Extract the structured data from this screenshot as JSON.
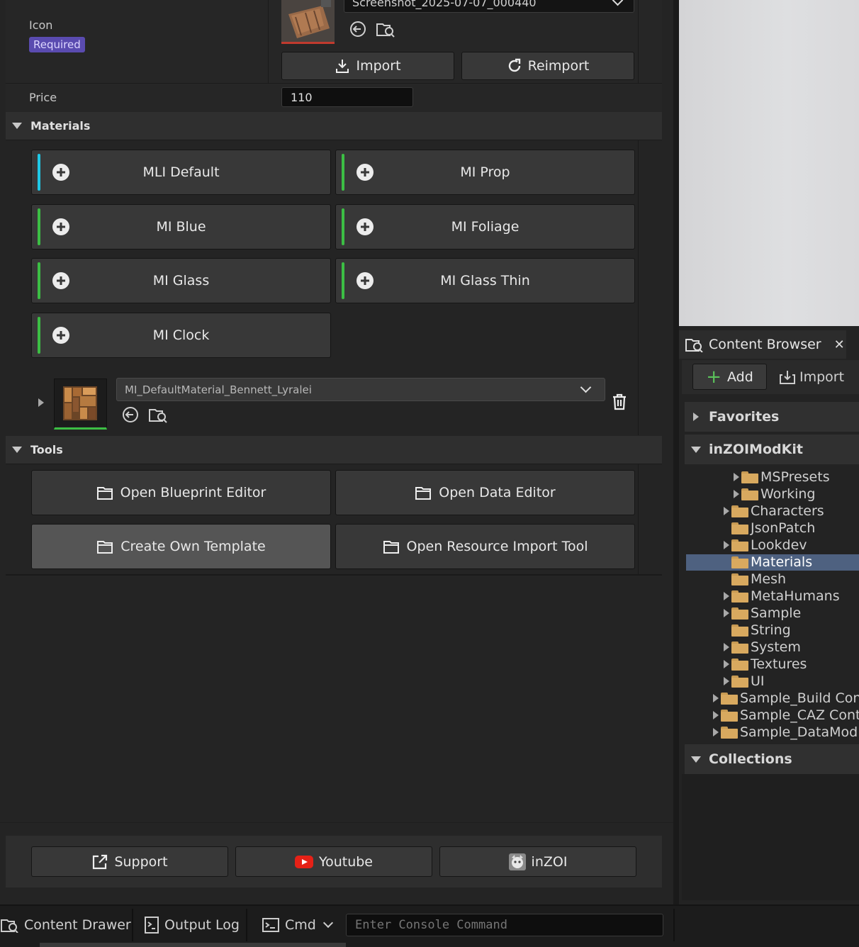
{
  "details": {
    "icon_label": "Icon",
    "required_badge": "Required",
    "icon_asset_name": "Screenshot_2025-07-07_000440",
    "import_label": "Import",
    "reimport_label": "Reimport",
    "price_label": "Price",
    "price_value": "110"
  },
  "materials": {
    "header": "Materials",
    "items": [
      {
        "label": "MLI Default",
        "accent": "#1ec8e6"
      },
      {
        "label": "MI Prop",
        "accent": "#3cbe44"
      },
      {
        "label": "MI Blue",
        "accent": "#3cbe44"
      },
      {
        "label": "MI Foliage",
        "accent": "#3cbe44"
      },
      {
        "label": "MI Glass",
        "accent": "#3cbe44"
      },
      {
        "label": "MI Glass Thin",
        "accent": "#3cbe44"
      },
      {
        "label": "MI Clock",
        "accent": "#3cbe44"
      }
    ],
    "selected_material": "MI_DefaultMaterial_Bennett_Lyralei"
  },
  "tools": {
    "header": "Tools",
    "open_blueprint_editor": "Open Blueprint Editor",
    "open_data_editor": "Open Data Editor",
    "create_own_template": "Create Own Template",
    "open_resource_import_tool": "Open Resource Import Tool"
  },
  "links": {
    "support": "Support",
    "youtube": "Youtube",
    "inzoi": "inZOI"
  },
  "content_browser": {
    "tab_title": "Content Browser",
    "add_label": "Add",
    "import_label": "Import",
    "favorites_label": "Favorites",
    "root_label": "inZOIModKit",
    "collections_label": "Collections",
    "tree": [
      {
        "label": "MSPresets",
        "expandable": true,
        "selected": false
      },
      {
        "label": "Working",
        "expandable": true,
        "selected": false
      },
      {
        "label": "Characters",
        "expandable": true,
        "selected": false
      },
      {
        "label": "JsonPatch",
        "expandable": false,
        "selected": false
      },
      {
        "label": "Lookdev",
        "expandable": true,
        "selected": false
      },
      {
        "label": "Materials",
        "expandable": false,
        "selected": true
      },
      {
        "label": "Mesh",
        "expandable": false,
        "selected": false
      },
      {
        "label": "MetaHumans",
        "expandable": true,
        "selected": false
      },
      {
        "label": "Sample",
        "expandable": true,
        "selected": false
      },
      {
        "label": "String",
        "expandable": false,
        "selected": false
      },
      {
        "label": "System",
        "expandable": true,
        "selected": false
      },
      {
        "label": "Textures",
        "expandable": true,
        "selected": false
      },
      {
        "label": "UI",
        "expandable": true,
        "selected": false
      },
      {
        "label": "Sample_Build Cont",
        "expandable": true,
        "selected": false
      },
      {
        "label": "Sample_CAZ Conte",
        "expandable": true,
        "selected": false
      },
      {
        "label": "Sample_DataMod",
        "expandable": true,
        "selected": false
      }
    ]
  },
  "status_bar": {
    "content_drawer": "Content Drawer",
    "output_log": "Output Log",
    "cmd": "Cmd",
    "console_placeholder": "Enter Console Command"
  }
}
